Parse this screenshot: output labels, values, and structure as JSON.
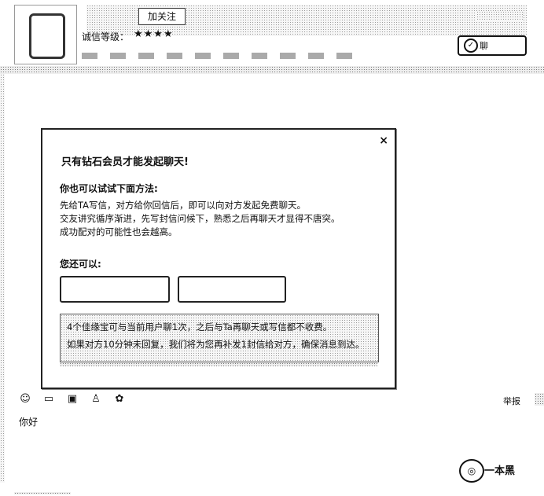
{
  "header": {
    "follow_label": "加关注",
    "credit_label": "诚信等级：",
    "stars": "★★★★",
    "status_label": "聊",
    "status_check": "✓"
  },
  "modal": {
    "title": "只有钻石会员才能发起聊天!",
    "close": "×",
    "try_title": "你也可以试试下面方法:",
    "lines": [
      "先给TA写信，对方给你回信后，即可以向对方发起免费聊天。",
      "交友讲究循序渐进，先写封信问候下，熟悉之后再聊天才显得不唐突。",
      "成功配对的可能性也会越高。"
    ],
    "also_title": "您还可以:",
    "info_lines": [
      "4个佳缘宝可与当前用户聊1次，之后与Ta再聊天或写信都不收费。",
      "如果对方10分钟未回复，我们将为您再补发1封信给对方，确保消息到达。"
    ]
  },
  "toolbar": {
    "icons": [
      "smile-icon",
      "chat-icon",
      "image-icon",
      "person-icon",
      "gift-icon"
    ],
    "glyphs": [
      "☺",
      "▭",
      "▣",
      "♙",
      "✿"
    ],
    "report": "举报"
  },
  "chat": {
    "message": "你好"
  },
  "watermark": {
    "text": "一本黑"
  }
}
